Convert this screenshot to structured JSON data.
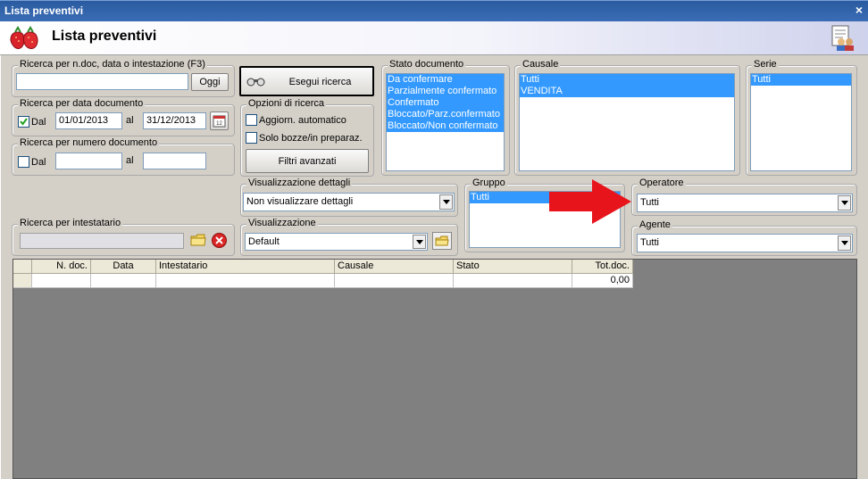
{
  "window": {
    "title": "Lista preventivi",
    "close_label": "×"
  },
  "header": {
    "title": "Lista preventivi",
    "logo_icon": "strawberry-icon",
    "user_icon": "users-report-icon"
  },
  "search_text": {
    "legend": "Ricerca per n.doc, data o intestazione (F3)",
    "value": "",
    "button": "Oggi"
  },
  "run_search": {
    "label": "Esegui ricerca",
    "icon": "binoculars-icon"
  },
  "search_date": {
    "legend": "Ricerca per data documento",
    "dal_label": "Dal",
    "checked": true,
    "from": "01/01/2013",
    "al_label": "al",
    "to": "31/12/2013",
    "calendar_icon": "calendar-icon"
  },
  "search_number": {
    "legend": "Ricerca per numero documento",
    "dal_label": "Dal",
    "checked": false,
    "from": "",
    "al_label": "al",
    "to": ""
  },
  "options": {
    "legend": "Opzioni di ricerca",
    "auto_update": "Aggiorn. automatico",
    "drafts": "Solo bozze/in preparaz.",
    "advanced": "Filtri avanzati"
  },
  "status": {
    "legend": "Stato documento",
    "items": [
      "Da confermare",
      "Parzialmente confermato",
      "Confermato",
      "Bloccato/Parz.confermato",
      "Bloccato/Non confermato"
    ]
  },
  "causale": {
    "legend": "Causale",
    "items": [
      "Tutti",
      "VENDITA"
    ]
  },
  "serie": {
    "legend": "Serie",
    "items": [
      "Tutti"
    ]
  },
  "details": {
    "legend": "Visualizzazione dettagli",
    "value": "Non visualizzare dettagli"
  },
  "group": {
    "legend": "Gruppo",
    "items": [
      "Tutti"
    ]
  },
  "operator": {
    "legend": "Operatore",
    "value": "Tutti"
  },
  "agent": {
    "legend": "Agente",
    "value": "Tutti"
  },
  "holder": {
    "legend": "Ricerca per intestatario",
    "value": ""
  },
  "view": {
    "legend": "Visualizzazione",
    "value": "Default"
  },
  "table": {
    "columns": [
      "N. doc.",
      "Data",
      "Intestatario",
      "Causale",
      "Stato",
      "Tot.doc."
    ],
    "rows": [
      [
        "",
        "",
        "",
        "",
        "",
        "0,00"
      ]
    ]
  },
  "colors": {
    "title_bar": "#2a5ba0",
    "selection": "#3399ff",
    "arrow": "#e8141c",
    "grid_bg": "#808080"
  }
}
